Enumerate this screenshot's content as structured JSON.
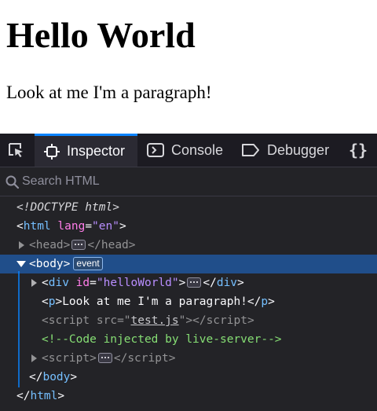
{
  "page": {
    "heading": "Hello World",
    "paragraph": "Look at me I'm a paragraph!"
  },
  "devtools": {
    "tabs": {
      "inspector": "Inspector",
      "console": "Console",
      "debugger": "Debugger"
    },
    "search": {
      "placeholder": "Search HTML"
    },
    "tree": {
      "doctype": "<!DOCTYPE html>",
      "html_open": "html",
      "html_lang_attr": "lang",
      "html_lang_value": "\"en\"",
      "head": "head",
      "body": "body",
      "event_badge": "event",
      "div": "div",
      "div_id_attr": "id",
      "div_id_value": "\"helloWorld\"",
      "p": "p",
      "p_text": "Look at me I'm a paragraph!",
      "script": "script",
      "script_src_attr": "src",
      "script_src_value": "test.js",
      "comment": "<!--Code injected by live-server-->",
      "html_close": "html"
    },
    "colors": {
      "accent": "#0a84ff",
      "selected_row": "#204e8a",
      "tag": "#75bfff",
      "attr_name": "#ff7de9",
      "attr_value": "#b98eff",
      "comment": "#86de74"
    }
  }
}
